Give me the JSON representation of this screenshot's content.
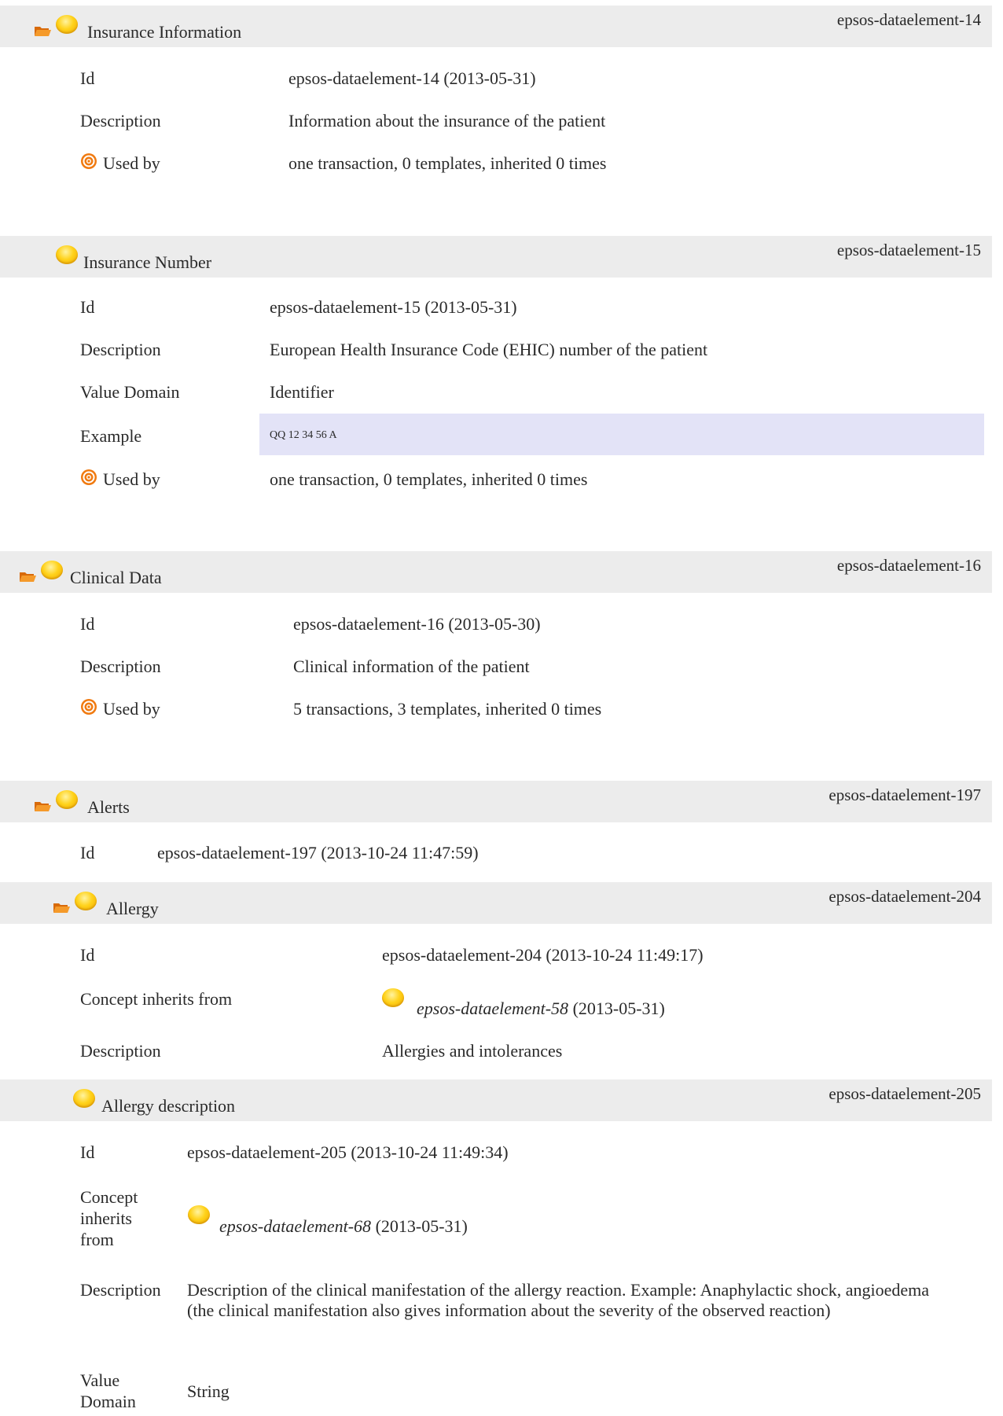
{
  "sections": [
    {
      "title": "Insurance Information",
      "id_right": "epsos-dataelement-14",
      "rows": [
        {
          "label": "Id",
          "value": "epsos-dataelement-14 (2013-05-31)"
        },
        {
          "label": "Description",
          "value": "Information about the insurance of the patient"
        },
        {
          "label": "Used by",
          "value": "one transaction, 0 templates, inherited 0 times"
        }
      ]
    },
    {
      "title": "Insurance Number",
      "id_right": "epsos-dataelement-15",
      "rows": [
        {
          "label": "Id",
          "value": "epsos-dataelement-15 (2013-05-31)"
        },
        {
          "label": "Description",
          "value": "European Health Insurance Code (EHIC) number of the patient"
        },
        {
          "label": "Value Domain",
          "value": "Identifier"
        },
        {
          "label": "Example",
          "value": "QQ 12 34 56 A"
        },
        {
          "label": "Used by",
          "value": "one transaction, 0 templates, inherited 0 times"
        }
      ]
    },
    {
      "title": "Clinical Data",
      "id_right": "epsos-dataelement-16",
      "rows": [
        {
          "label": "Id",
          "value": "epsos-dataelement-16 (2013-05-30)"
        },
        {
          "label": "Description",
          "value": "Clinical information of the patient"
        },
        {
          "label": "Used by",
          "value": "5 transactions, 3 templates, inherited 0 times"
        }
      ]
    },
    {
      "title": "Alerts",
      "id_right": "epsos-dataelement-197",
      "rows": [
        {
          "label": "Id",
          "value": "epsos-dataelement-197 (2013-10-24 11:47:59)"
        }
      ]
    },
    {
      "title": "Allergy",
      "id_right": "epsos-dataelement-204",
      "rows": [
        {
          "label": "Id",
          "value": "epsos-dataelement-204 (2013-10-24 11:49:17)"
        },
        {
          "label": "Concept inherits from",
          "link": "epsos-dataelement-58",
          "value": "(2013-05-31)"
        },
        {
          "label": "Description",
          "value": "Allergies and intolerances"
        }
      ]
    },
    {
      "title": "Allergy description",
      "id_right": "epsos-dataelement-205",
      "rows": [
        {
          "label": "Id",
          "value": "epsos-dataelement-205 (2013-10-24 11:49:34)"
        },
        {
          "label": "Concept inherits from",
          "link": "epsos-dataelement-68",
          "value": "(2013-05-31)"
        },
        {
          "label": "Description",
          "value": "Description of the clinical manifestation of the allergy reaction. Example: Anaphylactic shock, angioedema (the clinical manifestation also gives information about the severity of the observed reaction)"
        },
        {
          "label": "Value Domain",
          "value": "String"
        }
      ]
    }
  ],
  "colors": {
    "header_bg": "#ececec",
    "example_bg": "#e3e3f7",
    "ball": "#ffd21a",
    "folder": "#f08a1c",
    "target": "#f07a10"
  },
  "icons": [
    "folder-open-icon",
    "concept-ball-icon",
    "target-icon"
  ]
}
